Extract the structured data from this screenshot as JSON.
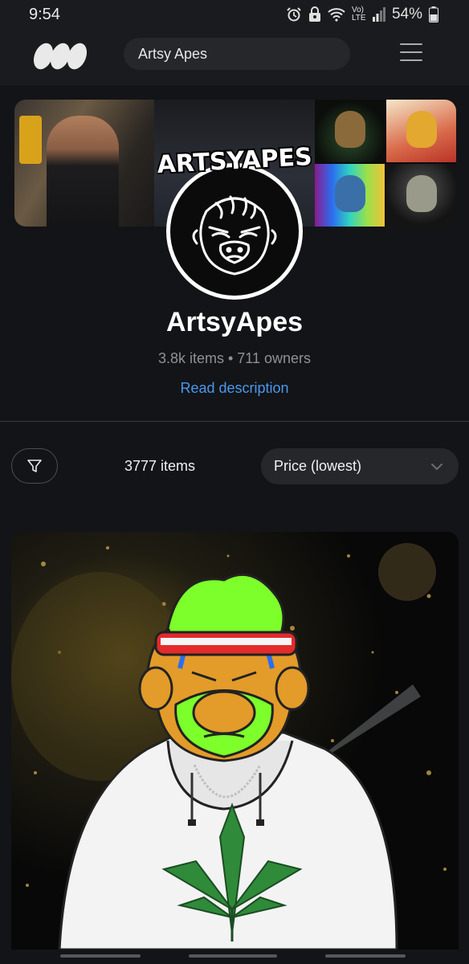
{
  "status_bar": {
    "time": "9:54",
    "network": "Vo) LTE",
    "battery": "54%",
    "icons": [
      "alarm-icon",
      "vpn-icon",
      "wifi-icon",
      "signal-icon",
      "battery-icon"
    ]
  },
  "nav": {
    "logo_icon": "opensea-logo-icon",
    "search_value": "Artsy Apes",
    "menu_icon": "hamburger-menu-icon"
  },
  "collection": {
    "avatar_wordmark": "ARTSYAPES",
    "name": "ArtsyApes",
    "stats": "3.8k items • 711 owners",
    "read_description": "Read description"
  },
  "toolbar": {
    "filter_icon": "filter-icon",
    "items_count": "3777 items",
    "sort_selected": "Price (lowest)",
    "sort_chevron_icon": "chevron-down-icon"
  },
  "colors": {
    "background": "#131417",
    "nav_background": "#1a1b1e",
    "link": "#4a98f0",
    "muted_text": "#8e9198",
    "pill": "#25272b"
  }
}
